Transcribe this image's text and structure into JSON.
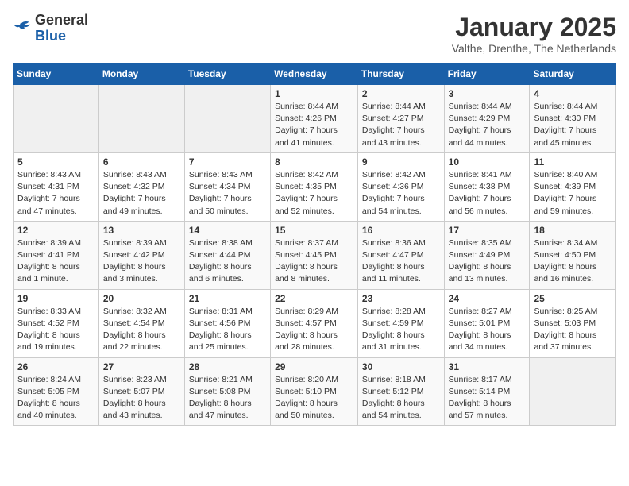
{
  "logo": {
    "general": "General",
    "blue": "Blue"
  },
  "header": {
    "month": "January 2025",
    "location": "Valthe, Drenthe, The Netherlands"
  },
  "weekdays": [
    "Sunday",
    "Monday",
    "Tuesday",
    "Wednesday",
    "Thursday",
    "Friday",
    "Saturday"
  ],
  "weeks": [
    [
      {
        "day": "",
        "info": ""
      },
      {
        "day": "",
        "info": ""
      },
      {
        "day": "",
        "info": ""
      },
      {
        "day": "1",
        "info": "Sunrise: 8:44 AM\nSunset: 4:26 PM\nDaylight: 7 hours\nand 41 minutes."
      },
      {
        "day": "2",
        "info": "Sunrise: 8:44 AM\nSunset: 4:27 PM\nDaylight: 7 hours\nand 43 minutes."
      },
      {
        "day": "3",
        "info": "Sunrise: 8:44 AM\nSunset: 4:29 PM\nDaylight: 7 hours\nand 44 minutes."
      },
      {
        "day": "4",
        "info": "Sunrise: 8:44 AM\nSunset: 4:30 PM\nDaylight: 7 hours\nand 45 minutes."
      }
    ],
    [
      {
        "day": "5",
        "info": "Sunrise: 8:43 AM\nSunset: 4:31 PM\nDaylight: 7 hours\nand 47 minutes."
      },
      {
        "day": "6",
        "info": "Sunrise: 8:43 AM\nSunset: 4:32 PM\nDaylight: 7 hours\nand 49 minutes."
      },
      {
        "day": "7",
        "info": "Sunrise: 8:43 AM\nSunset: 4:34 PM\nDaylight: 7 hours\nand 50 minutes."
      },
      {
        "day": "8",
        "info": "Sunrise: 8:42 AM\nSunset: 4:35 PM\nDaylight: 7 hours\nand 52 minutes."
      },
      {
        "day": "9",
        "info": "Sunrise: 8:42 AM\nSunset: 4:36 PM\nDaylight: 7 hours\nand 54 minutes."
      },
      {
        "day": "10",
        "info": "Sunrise: 8:41 AM\nSunset: 4:38 PM\nDaylight: 7 hours\nand 56 minutes."
      },
      {
        "day": "11",
        "info": "Sunrise: 8:40 AM\nSunset: 4:39 PM\nDaylight: 7 hours\nand 59 minutes."
      }
    ],
    [
      {
        "day": "12",
        "info": "Sunrise: 8:39 AM\nSunset: 4:41 PM\nDaylight: 8 hours\nand 1 minute."
      },
      {
        "day": "13",
        "info": "Sunrise: 8:39 AM\nSunset: 4:42 PM\nDaylight: 8 hours\nand 3 minutes."
      },
      {
        "day": "14",
        "info": "Sunrise: 8:38 AM\nSunset: 4:44 PM\nDaylight: 8 hours\nand 6 minutes."
      },
      {
        "day": "15",
        "info": "Sunrise: 8:37 AM\nSunset: 4:45 PM\nDaylight: 8 hours\nand 8 minutes."
      },
      {
        "day": "16",
        "info": "Sunrise: 8:36 AM\nSunset: 4:47 PM\nDaylight: 8 hours\nand 11 minutes."
      },
      {
        "day": "17",
        "info": "Sunrise: 8:35 AM\nSunset: 4:49 PM\nDaylight: 8 hours\nand 13 minutes."
      },
      {
        "day": "18",
        "info": "Sunrise: 8:34 AM\nSunset: 4:50 PM\nDaylight: 8 hours\nand 16 minutes."
      }
    ],
    [
      {
        "day": "19",
        "info": "Sunrise: 8:33 AM\nSunset: 4:52 PM\nDaylight: 8 hours\nand 19 minutes."
      },
      {
        "day": "20",
        "info": "Sunrise: 8:32 AM\nSunset: 4:54 PM\nDaylight: 8 hours\nand 22 minutes."
      },
      {
        "day": "21",
        "info": "Sunrise: 8:31 AM\nSunset: 4:56 PM\nDaylight: 8 hours\nand 25 minutes."
      },
      {
        "day": "22",
        "info": "Sunrise: 8:29 AM\nSunset: 4:57 PM\nDaylight: 8 hours\nand 28 minutes."
      },
      {
        "day": "23",
        "info": "Sunrise: 8:28 AM\nSunset: 4:59 PM\nDaylight: 8 hours\nand 31 minutes."
      },
      {
        "day": "24",
        "info": "Sunrise: 8:27 AM\nSunset: 5:01 PM\nDaylight: 8 hours\nand 34 minutes."
      },
      {
        "day": "25",
        "info": "Sunrise: 8:25 AM\nSunset: 5:03 PM\nDaylight: 8 hours\nand 37 minutes."
      }
    ],
    [
      {
        "day": "26",
        "info": "Sunrise: 8:24 AM\nSunset: 5:05 PM\nDaylight: 8 hours\nand 40 minutes."
      },
      {
        "day": "27",
        "info": "Sunrise: 8:23 AM\nSunset: 5:07 PM\nDaylight: 8 hours\nand 43 minutes."
      },
      {
        "day": "28",
        "info": "Sunrise: 8:21 AM\nSunset: 5:08 PM\nDaylight: 8 hours\nand 47 minutes."
      },
      {
        "day": "29",
        "info": "Sunrise: 8:20 AM\nSunset: 5:10 PM\nDaylight: 8 hours\nand 50 minutes."
      },
      {
        "day": "30",
        "info": "Sunrise: 8:18 AM\nSunset: 5:12 PM\nDaylight: 8 hours\nand 54 minutes."
      },
      {
        "day": "31",
        "info": "Sunrise: 8:17 AM\nSunset: 5:14 PM\nDaylight: 8 hours\nand 57 minutes."
      },
      {
        "day": "",
        "info": ""
      }
    ]
  ]
}
